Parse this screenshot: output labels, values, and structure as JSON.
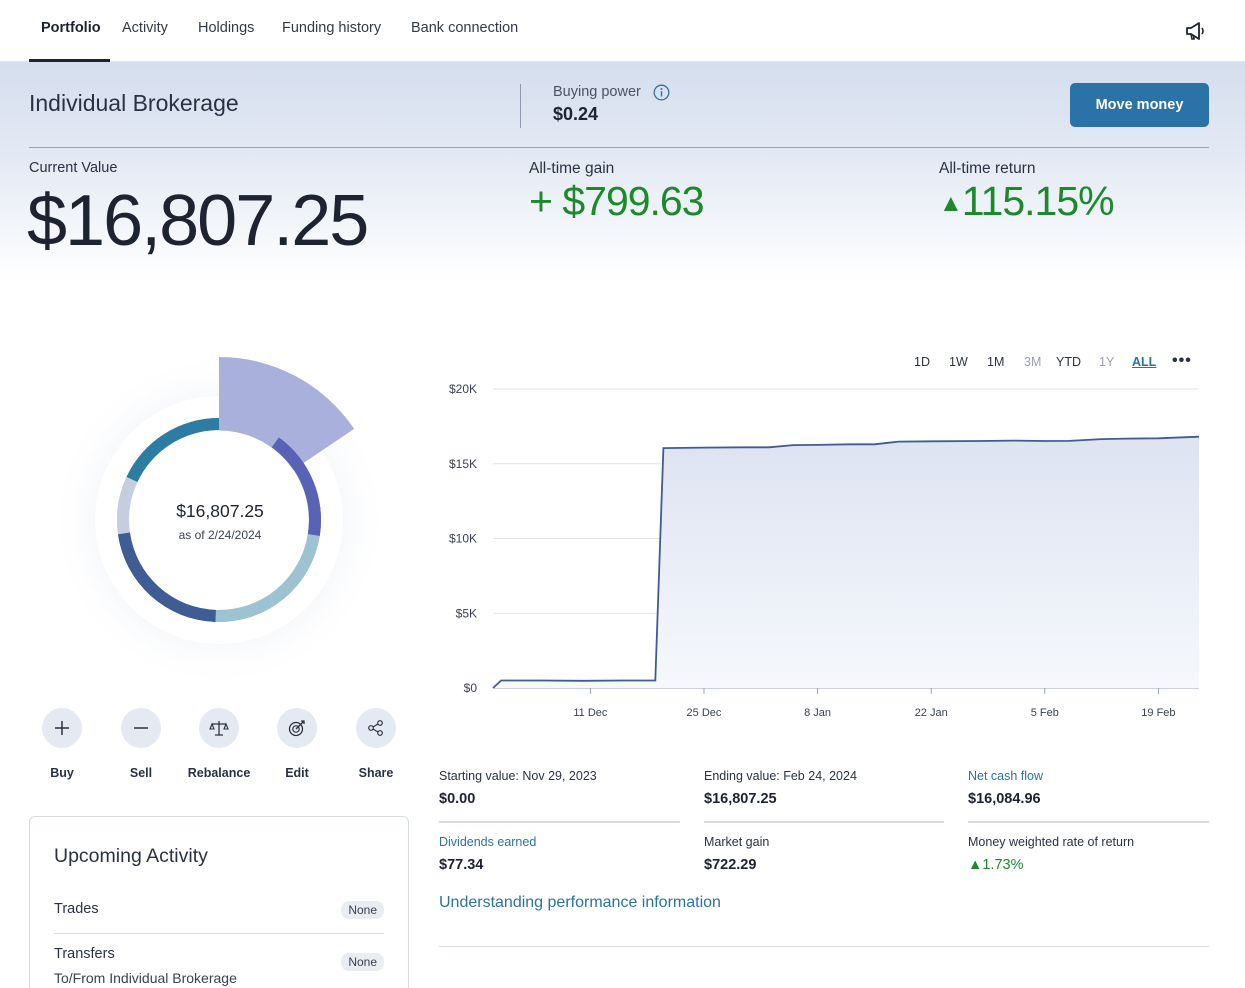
{
  "nav": {
    "tabs": [
      "Portfolio",
      "Activity",
      "Holdings",
      "Funding history",
      "Bank connection"
    ],
    "active_tab": "Portfolio",
    "announcements_icon": "megaphone-icon"
  },
  "account": {
    "name": "Individual Brokerage",
    "buying_power_label": "Buying power",
    "buying_power_value": "$0.24",
    "info_icon": "info-icon",
    "move_money_label": "Move money"
  },
  "summary": {
    "current_value_label": "Current Value",
    "current_value": "$16,807.25",
    "gain_label": "All-time gain",
    "gain_value": "+ $799.63",
    "return_label": "All-time return",
    "return_arrow": "▲",
    "return_value": "115.15%"
  },
  "donut": {
    "center_value": "$16,807.25",
    "center_date": "as of 2/24/2024",
    "segment_colors": [
      "#aab0dc",
      "#5764b5",
      "#9dc2d1",
      "#3f5c95",
      "#c5cedf",
      "#2d7ca3"
    ]
  },
  "actions": [
    {
      "label": "Buy",
      "icon": "plus-icon"
    },
    {
      "label": "Sell",
      "icon": "minus-icon"
    },
    {
      "label": "Rebalance",
      "icon": "scale-icon"
    },
    {
      "label": "Edit",
      "icon": "target-edit-icon"
    },
    {
      "label": "Share",
      "icon": "share-icon"
    }
  ],
  "upcoming": {
    "title": "Upcoming Activity",
    "rows": [
      {
        "label": "Trades",
        "badge": "None"
      },
      {
        "label": "Transfers",
        "sub": "To/From Individual Brokerage",
        "badge": "None"
      }
    ]
  },
  "chart_controls": {
    "ranges": [
      "1D",
      "1W",
      "1M",
      "3M",
      "YTD",
      "1Y",
      "ALL"
    ],
    "disabled": [
      "3M",
      "1Y"
    ],
    "selected": "ALL",
    "more_label": "•••"
  },
  "chart_data": {
    "type": "area",
    "title": "",
    "xlabel": "",
    "ylabel": "",
    "ylim": [
      0,
      20000
    ],
    "y_ticks": [
      "$0",
      "$5K",
      "$10K",
      "$15K",
      "$20K"
    ],
    "y_tick_values": [
      0,
      5000,
      10000,
      15000,
      20000
    ],
    "x_ticks": [
      "11 Dec",
      "25 Dec",
      "8 Jan",
      "22 Jan",
      "5 Feb",
      "19 Feb"
    ],
    "x_tick_dates": [
      "2023-12-11",
      "2023-12-25",
      "2024-01-08",
      "2024-01-22",
      "2024-02-05",
      "2024-02-19"
    ],
    "xlim": [
      "2023-11-29",
      "2024-02-24"
    ],
    "grid": true,
    "line_color": "#3f5c95",
    "fill_color": "#e6eaf5",
    "series": [
      {
        "x": [
          "2023-11-29",
          "2023-11-30",
          "2023-12-05",
          "2023-12-10",
          "2023-12-15",
          "2023-12-18",
          "2023-12-19",
          "2023-12-20",
          "2023-12-25",
          "2023-12-30",
          "2024-01-02",
          "2024-01-05",
          "2024-01-08",
          "2024-01-12",
          "2024-01-15",
          "2024-01-18",
          "2024-01-22",
          "2024-01-28",
          "2024-02-01",
          "2024-02-05",
          "2024-02-08",
          "2024-02-12",
          "2024-02-15",
          "2024-02-19",
          "2024-02-24"
        ],
        "values": [
          0,
          500,
          500,
          480,
          500,
          500,
          500,
          16050,
          16080,
          16100,
          16100,
          16250,
          16260,
          16300,
          16300,
          16480,
          16500,
          16520,
          16550,
          16520,
          16530,
          16650,
          16680,
          16700,
          16807
        ]
      }
    ]
  },
  "stats": [
    {
      "label": "Starting value: Nov 29, 2023",
      "value": "$0.00",
      "link": false
    },
    {
      "label": "Ending value: Feb 24, 2024",
      "value": "$16,807.25",
      "link": false
    },
    {
      "label": "Net cash flow",
      "value": "$16,084.96",
      "link": true
    },
    {
      "label": "Dividends earned",
      "value": "$77.34",
      "link": true
    },
    {
      "label": "Market gain",
      "value": "$722.29",
      "link": false
    },
    {
      "label": "Money weighted rate of return",
      "value": "▲1.73%",
      "link": false
    }
  ],
  "performance_link": "Understanding performance information",
  "colors": {
    "brand_blue": "#2b72a6",
    "gain_green": "#1a8a2a"
  }
}
